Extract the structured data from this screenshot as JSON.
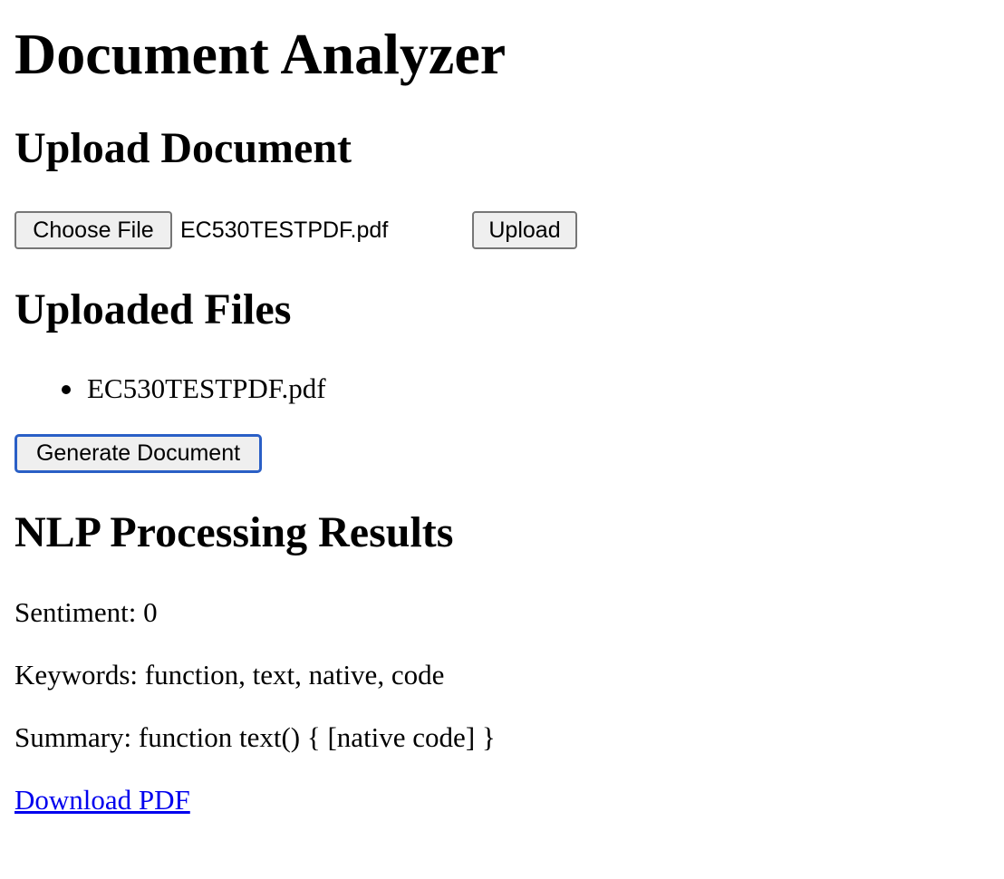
{
  "page": {
    "title": "Document Analyzer"
  },
  "upload": {
    "heading": "Upload Document",
    "choose_label": "Choose File",
    "file_name": "EC530TESTPDF.pdf",
    "upload_label": "Upload"
  },
  "uploaded": {
    "heading": "Uploaded Files",
    "files": [
      "EC530TESTPDF.pdf"
    ]
  },
  "actions": {
    "generate_label": "Generate Document"
  },
  "nlp": {
    "heading": "NLP Processing Results",
    "sentiment": "Sentiment: 0",
    "keywords": "Keywords: function, text, native, code",
    "summary": "Summary: function text() { [native code] }",
    "download_label": "Download PDF"
  },
  "colors": {
    "link": "#0000ee",
    "focus_ring": "#2a5fc6",
    "button_bg": "#efefef"
  }
}
